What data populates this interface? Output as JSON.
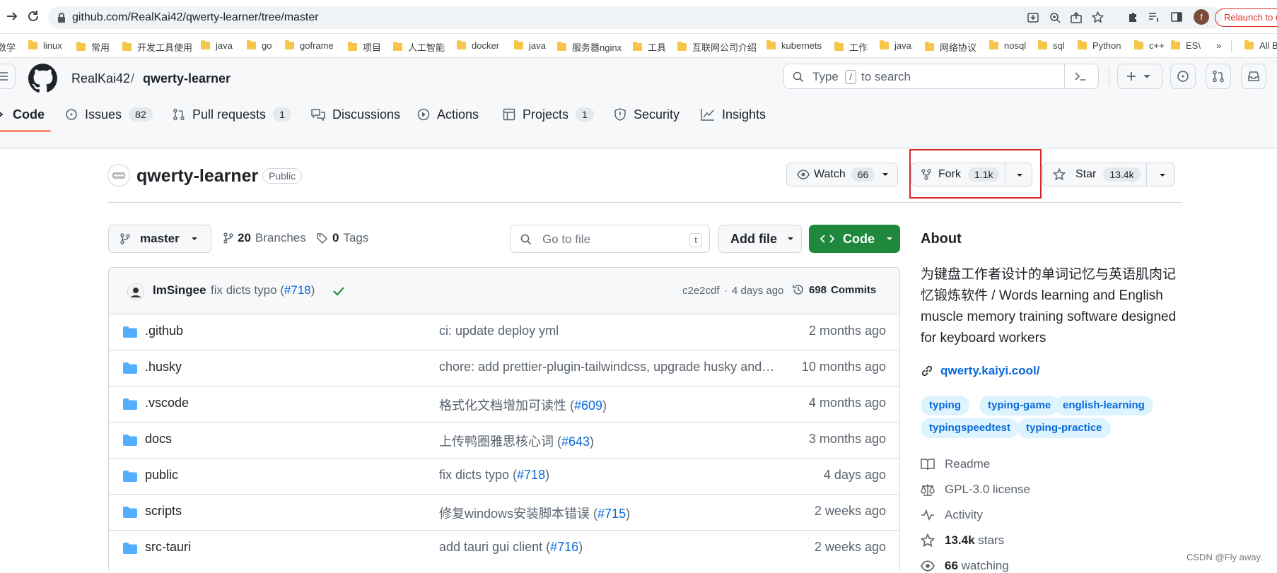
{
  "browser": {
    "url": "github.com/RealKai42/qwerty-learner/tree/master",
    "relaunch": "Relaunch to u",
    "profile_initial": "f",
    "bookmarks": [
      "数学",
      "linux",
      "常用",
      "开发工具使用",
      "java",
      "go",
      "goframe",
      "项目",
      "人工智能",
      "docker",
      "java",
      "服务器nginx",
      "工具",
      "互联网公司介绍",
      "kubernets",
      "工作",
      "java",
      "网络协议",
      "nosql",
      "sql",
      "Python",
      "c++",
      "ES\\"
    ],
    "bookmarks_more": "»",
    "all_bookmarks": "All B"
  },
  "header": {
    "owner": "RealKai42",
    "separator": "/",
    "repo": "qwerty-learner",
    "search_prefix": "Type",
    "search_key": "/",
    "search_suffix": "to search"
  },
  "tabs": [
    {
      "label": "Code"
    },
    {
      "label": "Issues",
      "count": "82"
    },
    {
      "label": "Pull requests",
      "count": "1"
    },
    {
      "label": "Discussions"
    },
    {
      "label": "Actions"
    },
    {
      "label": "Projects",
      "count": "1"
    },
    {
      "label": "Security"
    },
    {
      "label": "Insights"
    }
  ],
  "repo": {
    "name": "qwerty-learner",
    "visibility": "Public",
    "watch_label": "Watch",
    "watch_count": "66",
    "fork_label": "Fork",
    "fork_count": "1.1k",
    "star_label": "Star",
    "star_count": "13.4k"
  },
  "filebar": {
    "branch": "master",
    "branches_count": "20",
    "branches_label": "Branches",
    "tags_count": "0",
    "tags_label": "Tags",
    "goto_placeholder": "Go to file",
    "goto_key": "t",
    "add_file": "Add file",
    "code": "Code"
  },
  "commit": {
    "author": "lmSingee",
    "message": "fix dicts typo (",
    "pr": "#718",
    "message_end": ")",
    "hash": "c2e2cdf",
    "dot": "·",
    "when": "4 days ago",
    "commits_count": "698",
    "commits_label": "Commits"
  },
  "files": [
    {
      "name": ".github",
      "msg": "ci: update deploy yml",
      "pr": "",
      "time": "2 months ago"
    },
    {
      "name": ".husky",
      "msg": "chore: add prettier-plugin-tailwindcss, upgrade husky and li...",
      "pr": "",
      "time": "10 months ago"
    },
    {
      "name": ".vscode",
      "msg": "格式化文档增加可读性 (",
      "pr": "#609",
      "time": "4 months ago"
    },
    {
      "name": "docs",
      "msg": "上传鸭圈雅思核心词 (",
      "pr": "#643",
      "time": "3 months ago"
    },
    {
      "name": "public",
      "msg": "fix dicts typo (",
      "pr": "#718",
      "time": "4 days ago"
    },
    {
      "name": "scripts",
      "msg": "修复windows安装脚本错误 (",
      "pr": "#715",
      "time": "2 weeks ago"
    },
    {
      "name": "src-tauri",
      "msg": "add tauri gui client (",
      "pr": "#716",
      "time": "2 weeks ago"
    }
  ],
  "about": {
    "title": "About",
    "description": "为键盘工作者设计的单词记忆与英语肌肉记忆锻炼软件 / Words learning and English muscle memory training software designed for keyboard workers",
    "website": "qwerty.kaiyi.cool/",
    "topics": [
      "typing",
      "typing-game",
      "english-learning",
      "typingspeedtest",
      "typing-practice"
    ],
    "readme": "Readme",
    "license": "GPL-3.0 license",
    "activity": "Activity",
    "stars_count": "13.4k",
    "stars_label": "stars",
    "watching_count": "66",
    "watching_label": "watching"
  },
  "watermark": "CSDN @Fly away.",
  "colors": {
    "accent": "#0969da",
    "green": "#1f883d",
    "highlight_box": "#d9262c",
    "active_tab": "#fd8c73"
  }
}
